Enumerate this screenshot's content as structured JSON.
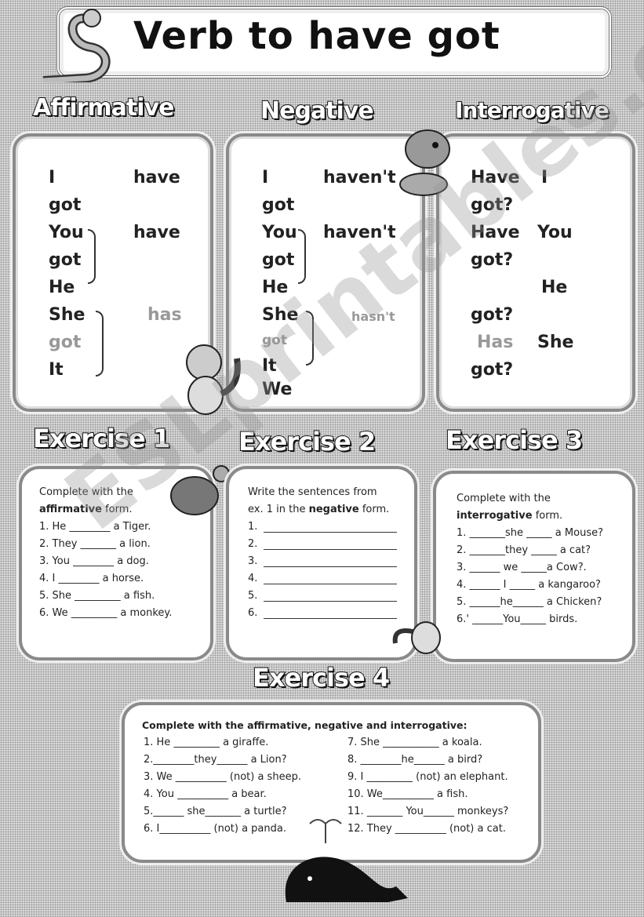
{
  "title": "Verb to have got",
  "watermark": "ESLprintables.com",
  "headings": {
    "affirmative": "Affirmative",
    "negative": "Negative",
    "interrogative": "Interrogative"
  },
  "affirmative": [
    "I",
    "have",
    "got",
    "You",
    "have",
    "got",
    "He",
    "She",
    "has",
    "got",
    "It"
  ],
  "negative": [
    "I",
    "haven't",
    "got",
    "You",
    "haven't",
    "got",
    "He",
    "She",
    "hasn't",
    "got",
    "It",
    "We"
  ],
  "interrogative": [
    "Have",
    "I",
    "got?",
    "Have",
    "You",
    "got?",
    "He",
    "got?",
    "Has",
    "She",
    "got?"
  ],
  "ex1": {
    "title": "Exercise 1",
    "instr1": "Complete with the",
    "instr_bold": "affirmative",
    "instr2": "form.",
    "items": [
      "1. He ________ a Tiger.",
      "2. They _______ a lion.",
      "3. You ________ a dog.",
      "4. I ________ a horse.",
      "5. She _________ a fish.",
      "6. We _________ a monkey."
    ]
  },
  "ex2": {
    "title": "Exercise 2",
    "instr1": "Write the sentences from",
    "instr2a": "ex. 1 in the",
    "instr_bold": "negative",
    "instr2b": "form.",
    "items": [
      "1.",
      "2.",
      "3.",
      "4.",
      "5.",
      "6."
    ]
  },
  "ex3": {
    "title": "Exercise 3",
    "instr1": "Complete with the",
    "instr_bold": "interrogative",
    "instr2": "form.",
    "items": [
      "1. _______she _____ a Mouse?",
      "2. _______they _____ a cat?",
      "3. ______ we _____a Cow?.",
      "4. ______ I _____ a kangaroo?",
      "5. ______he______ a Chicken?",
      "6.' ______You_____ birds."
    ]
  },
  "ex4": {
    "title": "Exercise 4",
    "instr": "Complete with the affirmative, negative and interrogative:",
    "left": [
      "1. He _________ a giraffe.",
      "2.________they______ a Lion?",
      "3. We __________ (not) a sheep.",
      "4. You __________ a bear.",
      "5.______ she_______ a turtle?",
      "6. I__________ (not) a panda."
    ],
    "right": [
      "7. She ___________ a koala.",
      "8. ________he______ a bird?",
      "9. I _________ (not) an elephant.",
      "10. We__________ a fish.",
      "11. _______ You______ monkeys?",
      "12. They __________ (not) a cat."
    ]
  }
}
